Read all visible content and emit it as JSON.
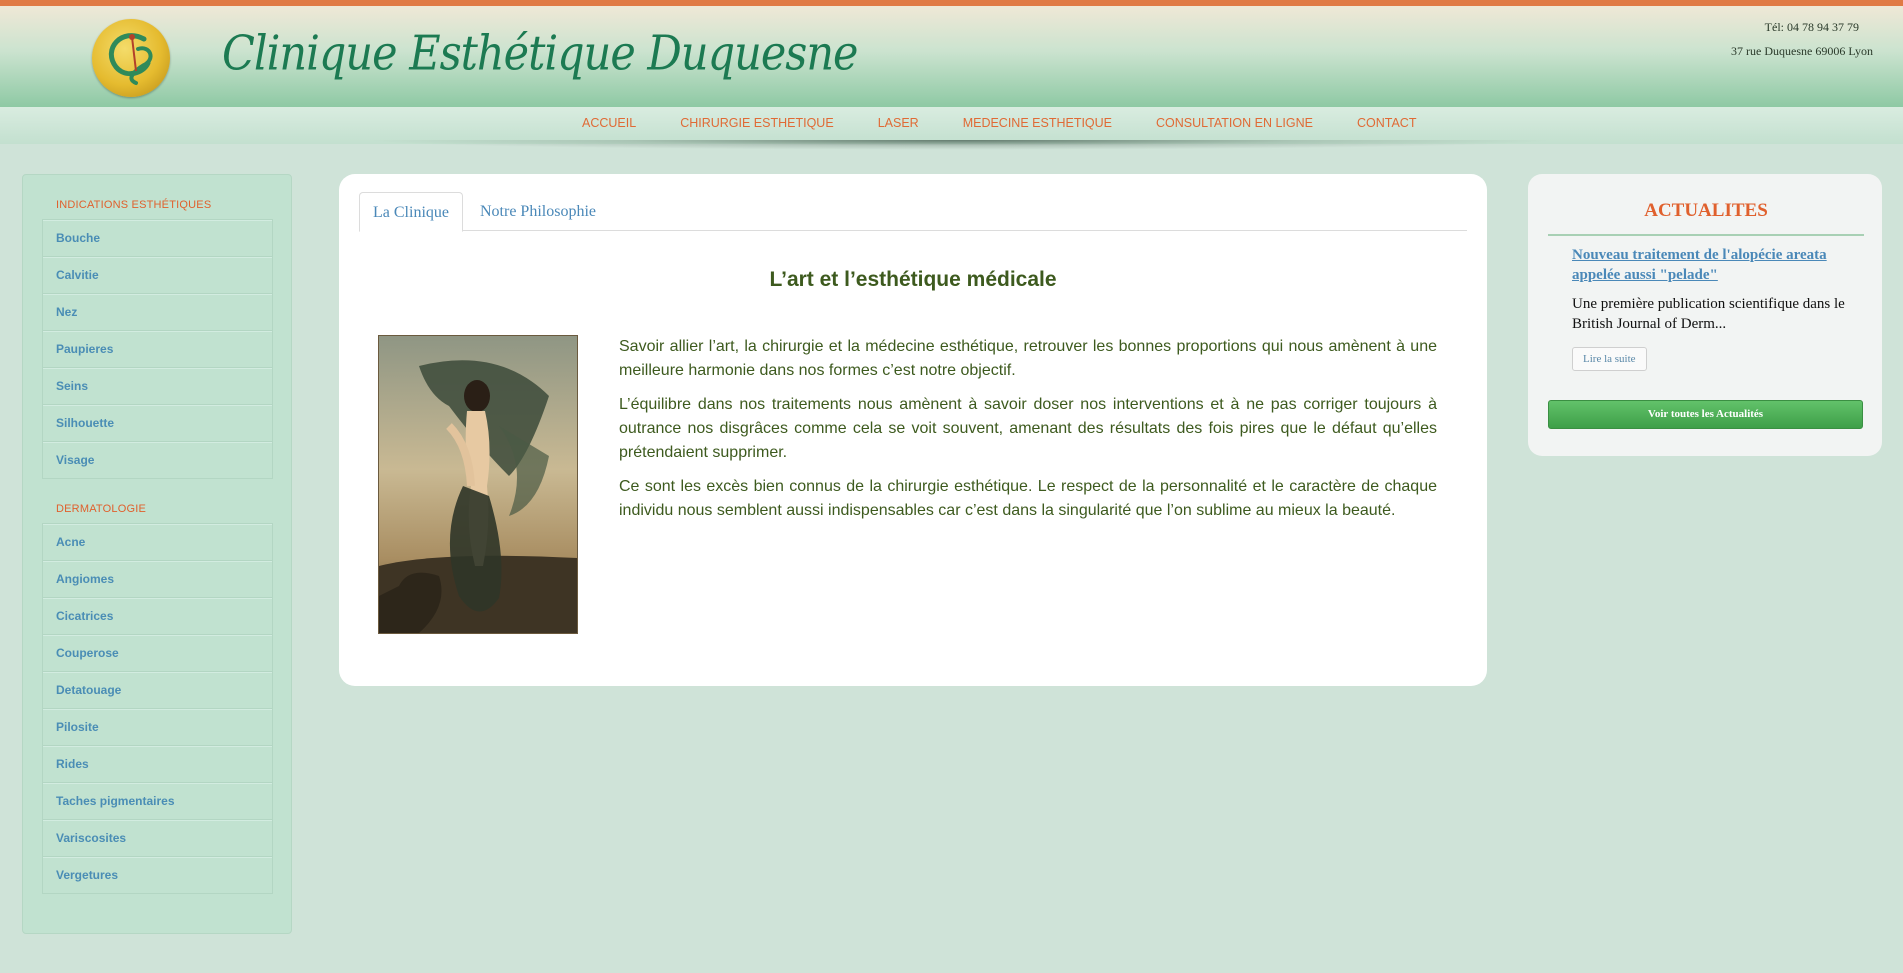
{
  "site": {
    "title": "Clinique Esthétique Duquesne",
    "phone": "Tél: 04 78 94 37 79",
    "address": "37 rue Duquesne 69006 Lyon"
  },
  "nav": {
    "items": [
      {
        "label": "ACCUEIL"
      },
      {
        "label": "CHIRURGIE ESTHETIQUE"
      },
      {
        "label": "LASER"
      },
      {
        "label": "MEDECINE ESTHETIQUE"
      },
      {
        "label": "CONSULTATION EN LIGNE"
      },
      {
        "label": "CONTACT"
      }
    ]
  },
  "sidebar": {
    "section1": {
      "title": "INDICATIONS ESTHÉTIQUES",
      "items": [
        "Bouche",
        "Calvitie",
        "Nez",
        "Paupieres",
        "Seins",
        "Silhouette",
        "Visage"
      ]
    },
    "section2": {
      "title": "DERMATOLOGIE",
      "items": [
        "Acne",
        "Angiomes",
        "Cicatrices",
        "Couperose",
        "Detatouage",
        "Pilosite",
        "Rides",
        "Taches pigmentaires",
        "Variscosites",
        "Vergetures"
      ]
    }
  },
  "main": {
    "tabs": [
      {
        "label": "La Clinique",
        "active": true
      },
      {
        "label": "Notre Philosophie",
        "active": false
      }
    ],
    "heading": "L’art et l’esthétique médicale",
    "paragraphs": [
      "Savoir allier l’art, la chirurgie et la médecine esthétique, retrouver les bonnes proportions qui nous amènent à une meilleure harmonie dans nos formes c’est notre objectif.",
      "L’équilibre dans nos traitements nous amènent à savoir doser nos interventions et à ne pas corriger toujours à outrance nos disgrâces comme cela se voit souvent, amenant des résultats des fois pires que le défaut qu’elles prétendaient supprimer.",
      "Ce sont les excès bien connus de la chirurgie esthétique. Le respect de la personnalité et le caractère de chaque individu nous semblent aussi indispensables car c’est dans la singularité que l’on sublime au mieux la beauté."
    ]
  },
  "news": {
    "title": "ACTUALITES",
    "headline": "Nouveau traitement de l'alopécie areata appelée aussi \"pelade\"",
    "excerpt": "Une première publication scientifique dans le British Journal of Derm...",
    "read_more": "Lire la suite",
    "all_news": "Voir toutes les Actualités"
  },
  "colors": {
    "accent_orange": "#e0602d",
    "title_green": "#1c7a52",
    "link_blue": "#4a88b8",
    "button_green": "#4caf50"
  }
}
